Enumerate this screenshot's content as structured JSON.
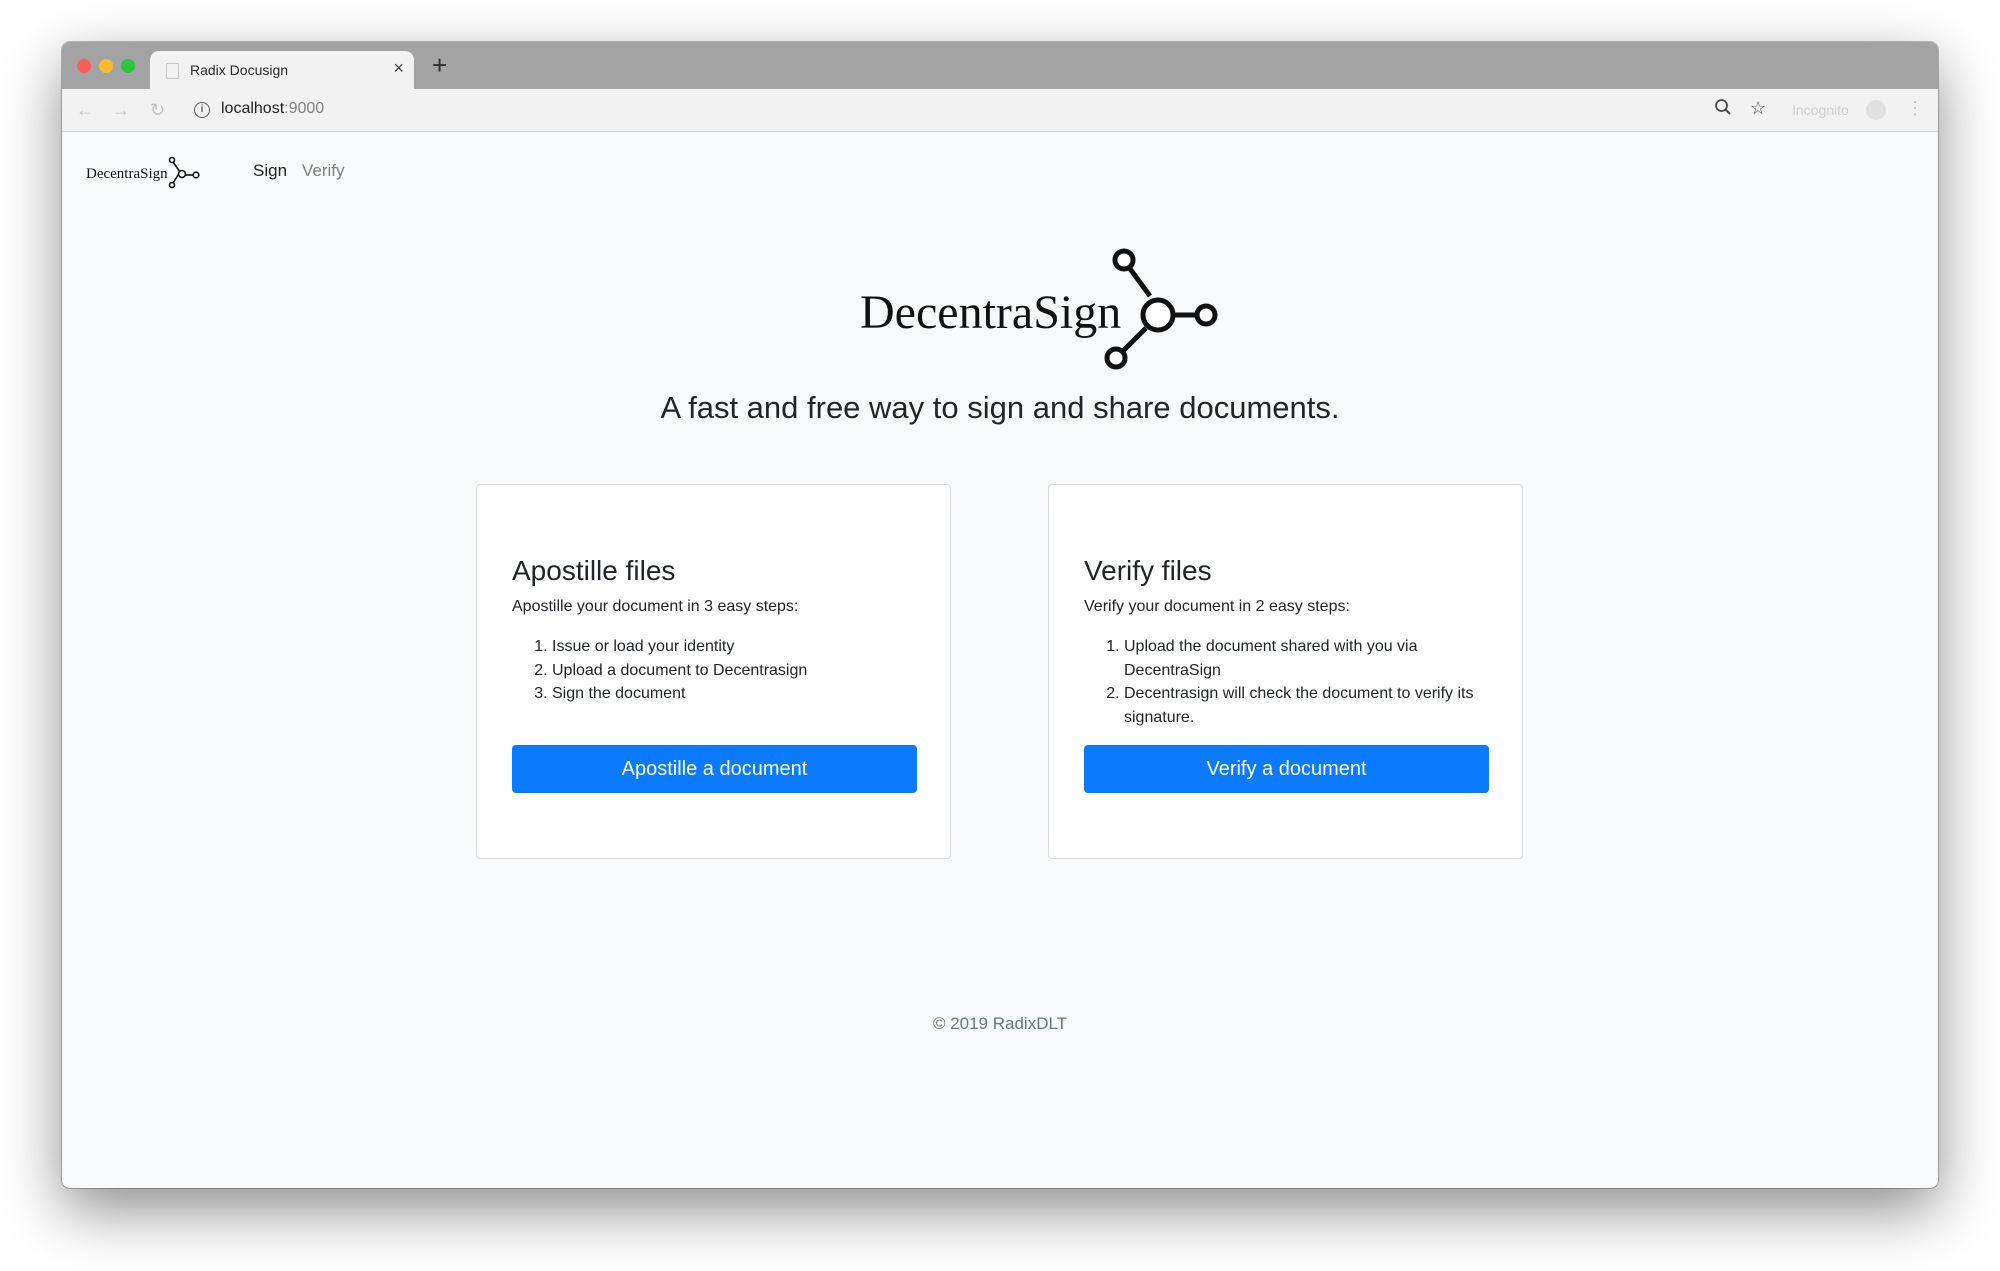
{
  "browser": {
    "tab_title": "Radix Docusign",
    "tab_close": "×",
    "new_tab": "+",
    "url_host": "localhost",
    "url_port": ":9000",
    "incognito_label": "Incognito",
    "icons": {
      "back": "arrow-left-icon",
      "forward": "arrow-right-icon",
      "reload": "reload-icon",
      "site_info": "info-icon",
      "zoom": "zoom-icon",
      "bookmark": "star-icon",
      "menu": "menu-icon"
    }
  },
  "nav": {
    "brand": "DecentraSign",
    "links": [
      "Sign",
      "Verify"
    ]
  },
  "hero": {
    "brand": "DecentraSign",
    "tagline": "A fast and free way to sign and share documents."
  },
  "cards": [
    {
      "title": "Apostille files",
      "intro": "Apostille your document in 3 easy steps:",
      "steps": [
        "Issue or load your identity",
        "Upload a document to Decentrasign",
        "Sign the document"
      ],
      "button": "Apostille a document"
    },
    {
      "title": "Verify files",
      "intro": "Verify your document in 2 easy steps:",
      "steps": [
        "Upload the document shared with you via DecentraSign",
        "Decentrasign will check the document to verify its signature."
      ],
      "button": "Verify a document"
    }
  ],
  "footer": "© 2019 RadixDLT",
  "colors": {
    "primary": "#0a7bff",
    "text": "#212529",
    "muted": "#6c757d"
  }
}
